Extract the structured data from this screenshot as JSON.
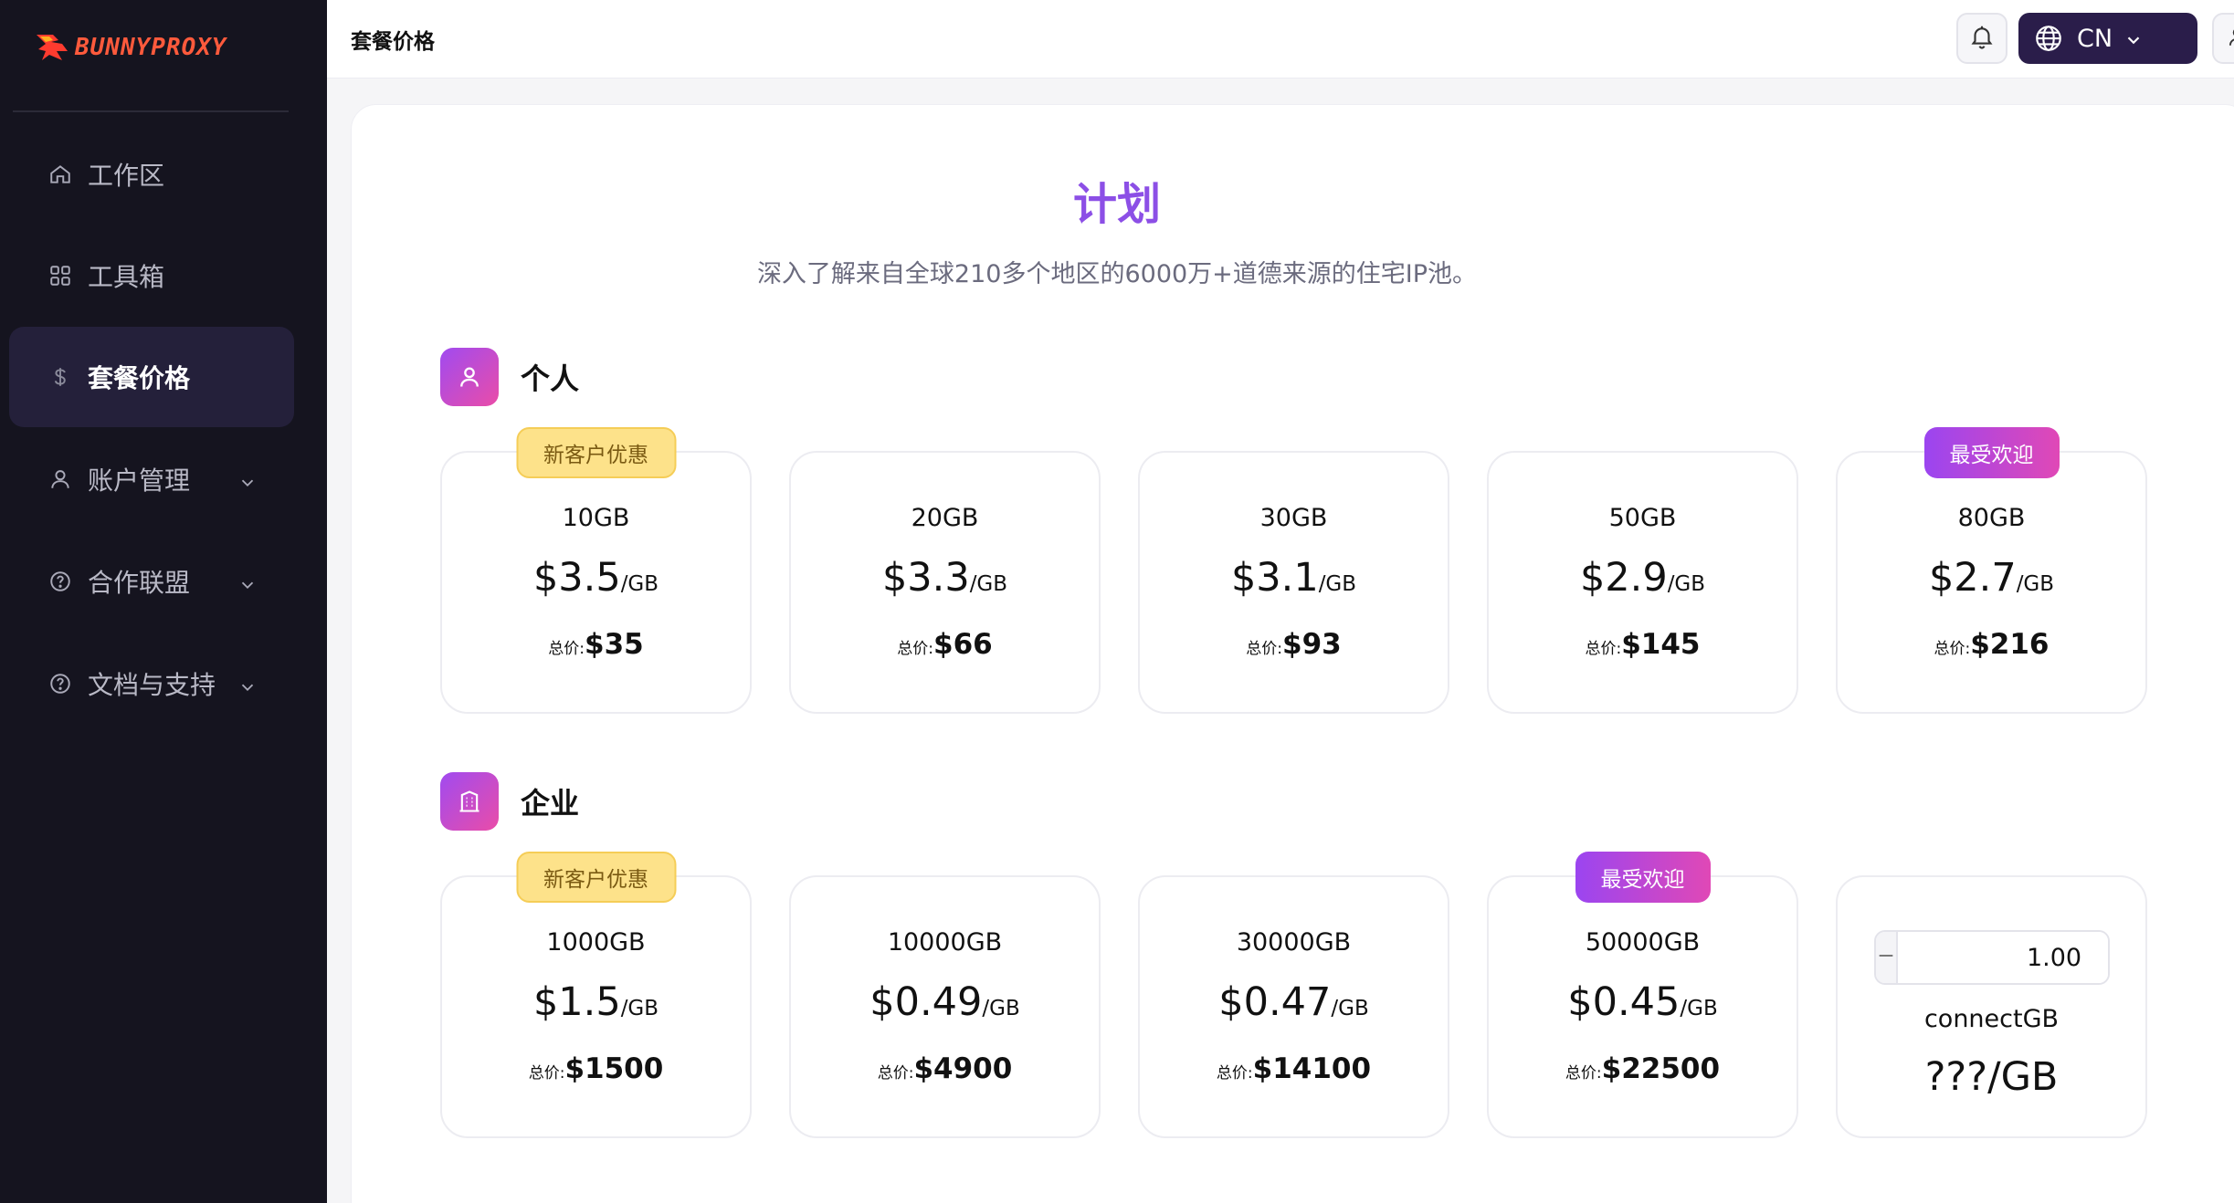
{
  "brand": {
    "name": "BUNNYPROXY",
    "accent": "#ff5a3c"
  },
  "sidebar": {
    "items": [
      {
        "label": "工作区",
        "icon": "home-icon"
      },
      {
        "label": "工具箱",
        "icon": "grid-icon"
      },
      {
        "label": "套餐价格",
        "icon": "dollar-icon",
        "active": true
      },
      {
        "label": "账户管理",
        "icon": "user-icon",
        "expandable": true
      },
      {
        "label": "合作联盟",
        "icon": "help-circle-icon",
        "expandable": true
      },
      {
        "label": "文档与支持",
        "icon": "help-circle-icon",
        "expandable": true
      }
    ]
  },
  "topbar": {
    "title": "套餐价格",
    "language": "CN"
  },
  "page": {
    "title": "计划",
    "subtitle": "深入了解来自全球210多个地区的6000万+道德来源的住宅IP池。",
    "title_color": "#8c4fe6"
  },
  "personal": {
    "label": "个人",
    "plans": [
      {
        "size": "10GB",
        "price": "$3.5",
        "unit": "/GB",
        "total_label": "总价:",
        "total": "$35",
        "badge": "新客户优惠",
        "badge_type": "new"
      },
      {
        "size": "20GB",
        "price": "$3.3",
        "unit": "/GB",
        "total_label": "总价:",
        "total": "$66"
      },
      {
        "size": "30GB",
        "price": "$3.1",
        "unit": "/GB",
        "total_label": "总价:",
        "total": "$93"
      },
      {
        "size": "50GB",
        "price": "$2.9",
        "unit": "/GB",
        "total_label": "总价:",
        "total": "$145"
      },
      {
        "size": "80GB",
        "price": "$2.7",
        "unit": "/GB",
        "total_label": "总价:",
        "total": "$216",
        "badge": "最受欢迎",
        "badge_type": "hot"
      }
    ]
  },
  "enterprise": {
    "label": "企业",
    "plans": [
      {
        "size": "1000GB",
        "price": "$1.5",
        "unit": "/GB",
        "total_label": "总价:",
        "total": "$1500",
        "badge": "新客户优惠",
        "badge_type": "new"
      },
      {
        "size": "10000GB",
        "price": "$0.49",
        "unit": "/GB",
        "total_label": "总价:",
        "total": "$4900"
      },
      {
        "size": "30000GB",
        "price": "$0.47",
        "unit": "/GB",
        "total_label": "总价:",
        "total": "$14100"
      },
      {
        "size": "50000GB",
        "price": "$0.45",
        "unit": "/GB",
        "total_label": "总价:",
        "total": "$22500",
        "badge": "最受欢迎",
        "badge_type": "hot"
      }
    ],
    "custom": {
      "value": "1.00",
      "label": "connectGB",
      "price": "???/GB"
    }
  }
}
